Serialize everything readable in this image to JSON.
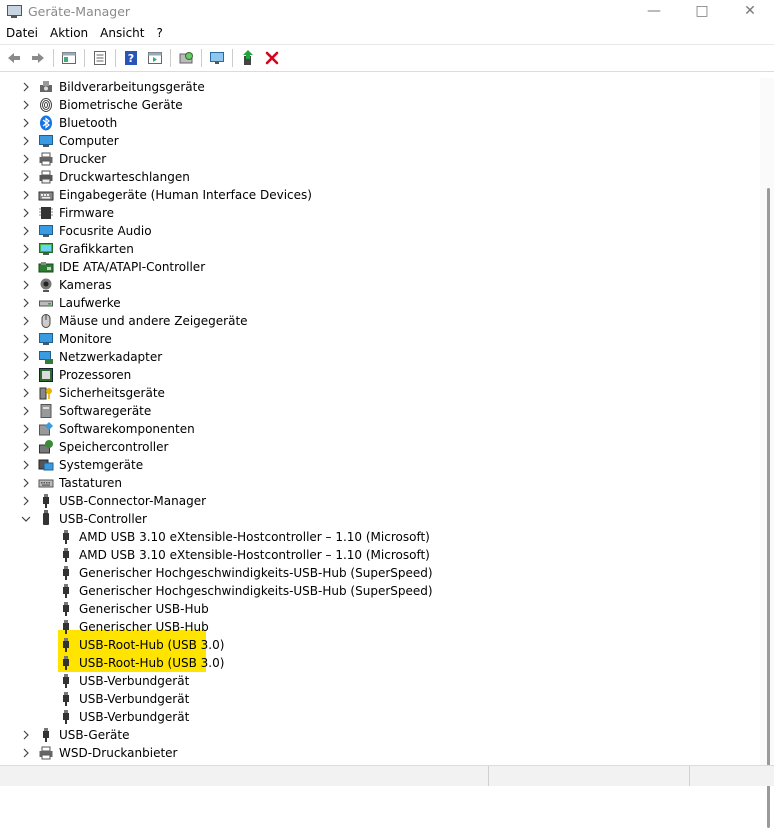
{
  "window": {
    "title": "Geräte-Manager"
  },
  "menu": [
    "Datei",
    "Aktion",
    "Ansicht",
    "?"
  ],
  "tree": {
    "categories_before": [
      {
        "label": "Bildverarbeitungsgeräte",
        "icon": "camera-scanner-icon"
      },
      {
        "label": "Biometrische Geräte",
        "icon": "fingerprint-icon"
      },
      {
        "label": "Bluetooth",
        "icon": "bluetooth-icon"
      },
      {
        "label": "Computer",
        "icon": "computer-icon"
      },
      {
        "label": "Drucker",
        "icon": "printer-icon"
      },
      {
        "label": "Druckwarteschlangen",
        "icon": "print-queue-icon"
      },
      {
        "label": "Eingabegeräte (Human Interface Devices)",
        "icon": "hid-icon"
      },
      {
        "label": "Firmware",
        "icon": "firmware-chip-icon"
      },
      {
        "label": "Focusrite Audio",
        "icon": "audio-monitor-icon"
      },
      {
        "label": "Grafikkarten",
        "icon": "display-adapter-icon"
      },
      {
        "label": "IDE ATA/ATAPI-Controller",
        "icon": "ide-controller-icon"
      },
      {
        "label": "Kameras",
        "icon": "webcam-icon"
      },
      {
        "label": "Laufwerke",
        "icon": "disk-drive-icon"
      },
      {
        "label": "Mäuse und andere Zeigegeräte",
        "icon": "mouse-icon"
      },
      {
        "label": "Monitore",
        "icon": "monitor-icon"
      },
      {
        "label": "Netzwerkadapter",
        "icon": "network-adapter-icon"
      },
      {
        "label": "Prozessoren",
        "icon": "processor-icon"
      },
      {
        "label": "Sicherheitsgeräte",
        "icon": "security-key-icon"
      },
      {
        "label": "Softwaregeräte",
        "icon": "software-device-icon"
      },
      {
        "label": "Softwarekomponenten",
        "icon": "software-component-icon"
      },
      {
        "label": "Speichercontroller",
        "icon": "storage-controller-icon"
      },
      {
        "label": "Systemgeräte",
        "icon": "system-device-icon"
      },
      {
        "label": "Tastaturen",
        "icon": "keyboard-icon"
      },
      {
        "label": "USB-Connector-Manager",
        "icon": "usb-icon"
      }
    ],
    "expanded": {
      "label": "USB-Controller",
      "children": [
        {
          "label": "AMD USB 3.10 eXtensible-Hostcontroller – 1.10 (Microsoft)",
          "highlight": false
        },
        {
          "label": "AMD USB 3.10 eXtensible-Hostcontroller – 1.10 (Microsoft)",
          "highlight": false
        },
        {
          "label": "Generischer Hochgeschwindigkeits-USB-Hub (SuperSpeed)",
          "highlight": false
        },
        {
          "label": "Generischer Hochgeschwindigkeits-USB-Hub (SuperSpeed)",
          "highlight": false
        },
        {
          "label": "Generischer USB-Hub",
          "highlight": false
        },
        {
          "label": "Generischer USB-Hub",
          "highlight": false
        },
        {
          "label": "USB-Root-Hub (USB 3.0)",
          "highlight": true
        },
        {
          "label": "USB-Root-Hub (USB 3.0)",
          "highlight": true
        },
        {
          "label": "USB-Verbundgerät",
          "highlight": false
        },
        {
          "label": "USB-Verbundgerät",
          "highlight": false
        },
        {
          "label": "USB-Verbundgerät",
          "highlight": false
        }
      ]
    },
    "categories_after": [
      {
        "label": "USB-Geräte",
        "icon": "usb-icon"
      },
      {
        "label": "WSD-Druckanbieter",
        "icon": "printer-icon"
      }
    ]
  },
  "colors": {
    "highlight": "#ffe100",
    "delete_red": "#d9001b",
    "accent_blue": "#3a8fd6"
  }
}
